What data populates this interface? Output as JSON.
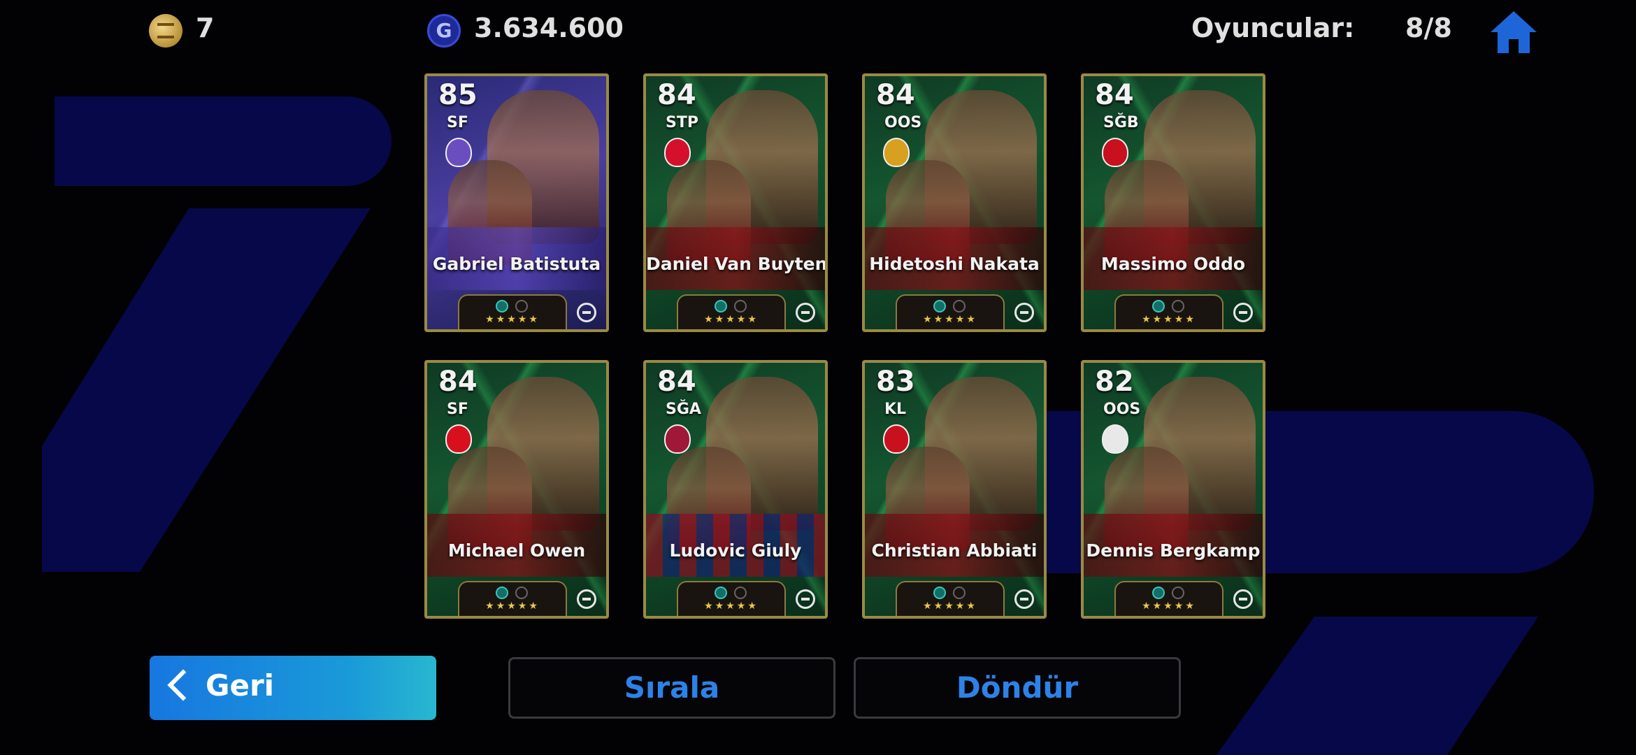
{
  "header": {
    "coin_value": "7",
    "gp_icon_letter": "G",
    "gp_value": "3.634.600",
    "players_label": "Oyuncular:",
    "players_count": "8/8"
  },
  "cards": [
    {
      "rating": "85",
      "position": "SF",
      "name": "Gabriel Batistuta",
      "club_color": "#6a4ec0"
    },
    {
      "rating": "84",
      "position": "STP",
      "name": "Daniel Van Buyten",
      "club_color": "#d4102c"
    },
    {
      "rating": "84",
      "position": "OOS",
      "name": "Hidetoshi Nakata",
      "club_color": "#d8a020"
    },
    {
      "rating": "84",
      "position": "SĞB",
      "name": "Massimo Oddo",
      "club_color": "#c8101e"
    },
    {
      "rating": "84",
      "position": "SF",
      "name": "Michael Owen",
      "club_color": "#d8101e"
    },
    {
      "rating": "84",
      "position": "SĞA",
      "name": "Ludovic Giuly",
      "club_color": "#a01838"
    },
    {
      "rating": "83",
      "position": "KL",
      "name": "Christian Abbiati",
      "club_color": "#c8101e"
    },
    {
      "rating": "82",
      "position": "OOS",
      "name": "Dennis Bergkamp",
      "club_color": "#e8e8e8"
    }
  ],
  "stars": "★★★★★",
  "buttons": {
    "back": "Geri",
    "sort": "Sırala",
    "flip": "Döndür"
  },
  "colors": {
    "accent_blue": "#2d82e8",
    "card_border_gold": "#9a8a44",
    "background": "#020204"
  }
}
